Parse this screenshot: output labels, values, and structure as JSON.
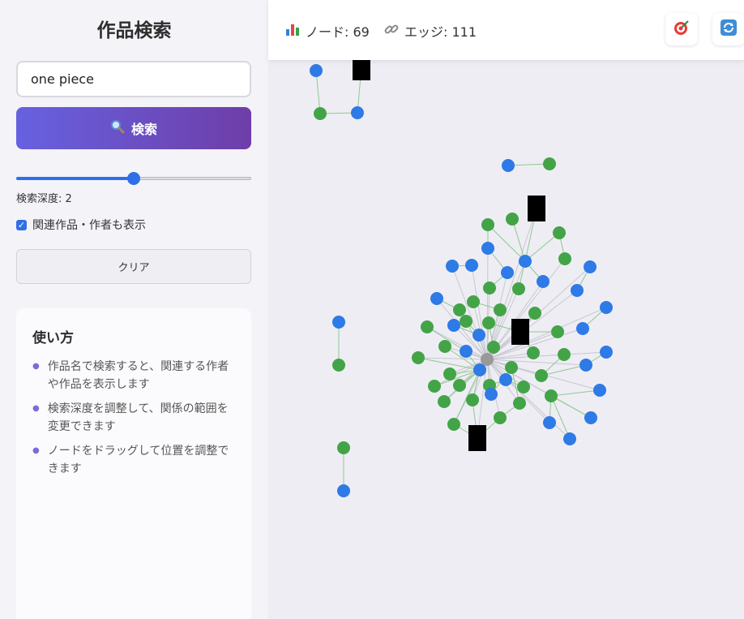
{
  "sidebar": {
    "title": "作品検索",
    "search": {
      "value": "one piece",
      "placeholder": ""
    },
    "search_button": {
      "icon": "magnifier-icon",
      "label": "検索"
    },
    "depth": {
      "label": "検索深度: 2",
      "value": 2,
      "min": 0,
      "max": 4
    },
    "related": {
      "label": "関連作品・作者も表示",
      "checked": true
    },
    "clear_button": "クリア",
    "help": {
      "title": "使い方",
      "items": [
        "作品名で検索すると、関連する作者や作品を表示します",
        "検索深度を調整して、関係の範囲を変更できます",
        "ノードをドラッグして位置を調整できます"
      ]
    }
  },
  "topbar": {
    "nodes_icon": "bar-chart-icon",
    "nodes": "ノード: 69",
    "edges_icon": "link-icon",
    "edges": "エッジ: 111",
    "center_icon": "target-icon",
    "refresh_icon": "refresh-icon"
  },
  "colors": {
    "accent_from": "#6761e0",
    "accent_to": "#6e3ea8",
    "work_node": "#43a447",
    "person_node": "#2e7ae6",
    "series_node": "#000000",
    "center_node": "#999999",
    "edge": "#8fc98f"
  },
  "graph": {
    "node_count": 69,
    "edge_count": 111
  }
}
